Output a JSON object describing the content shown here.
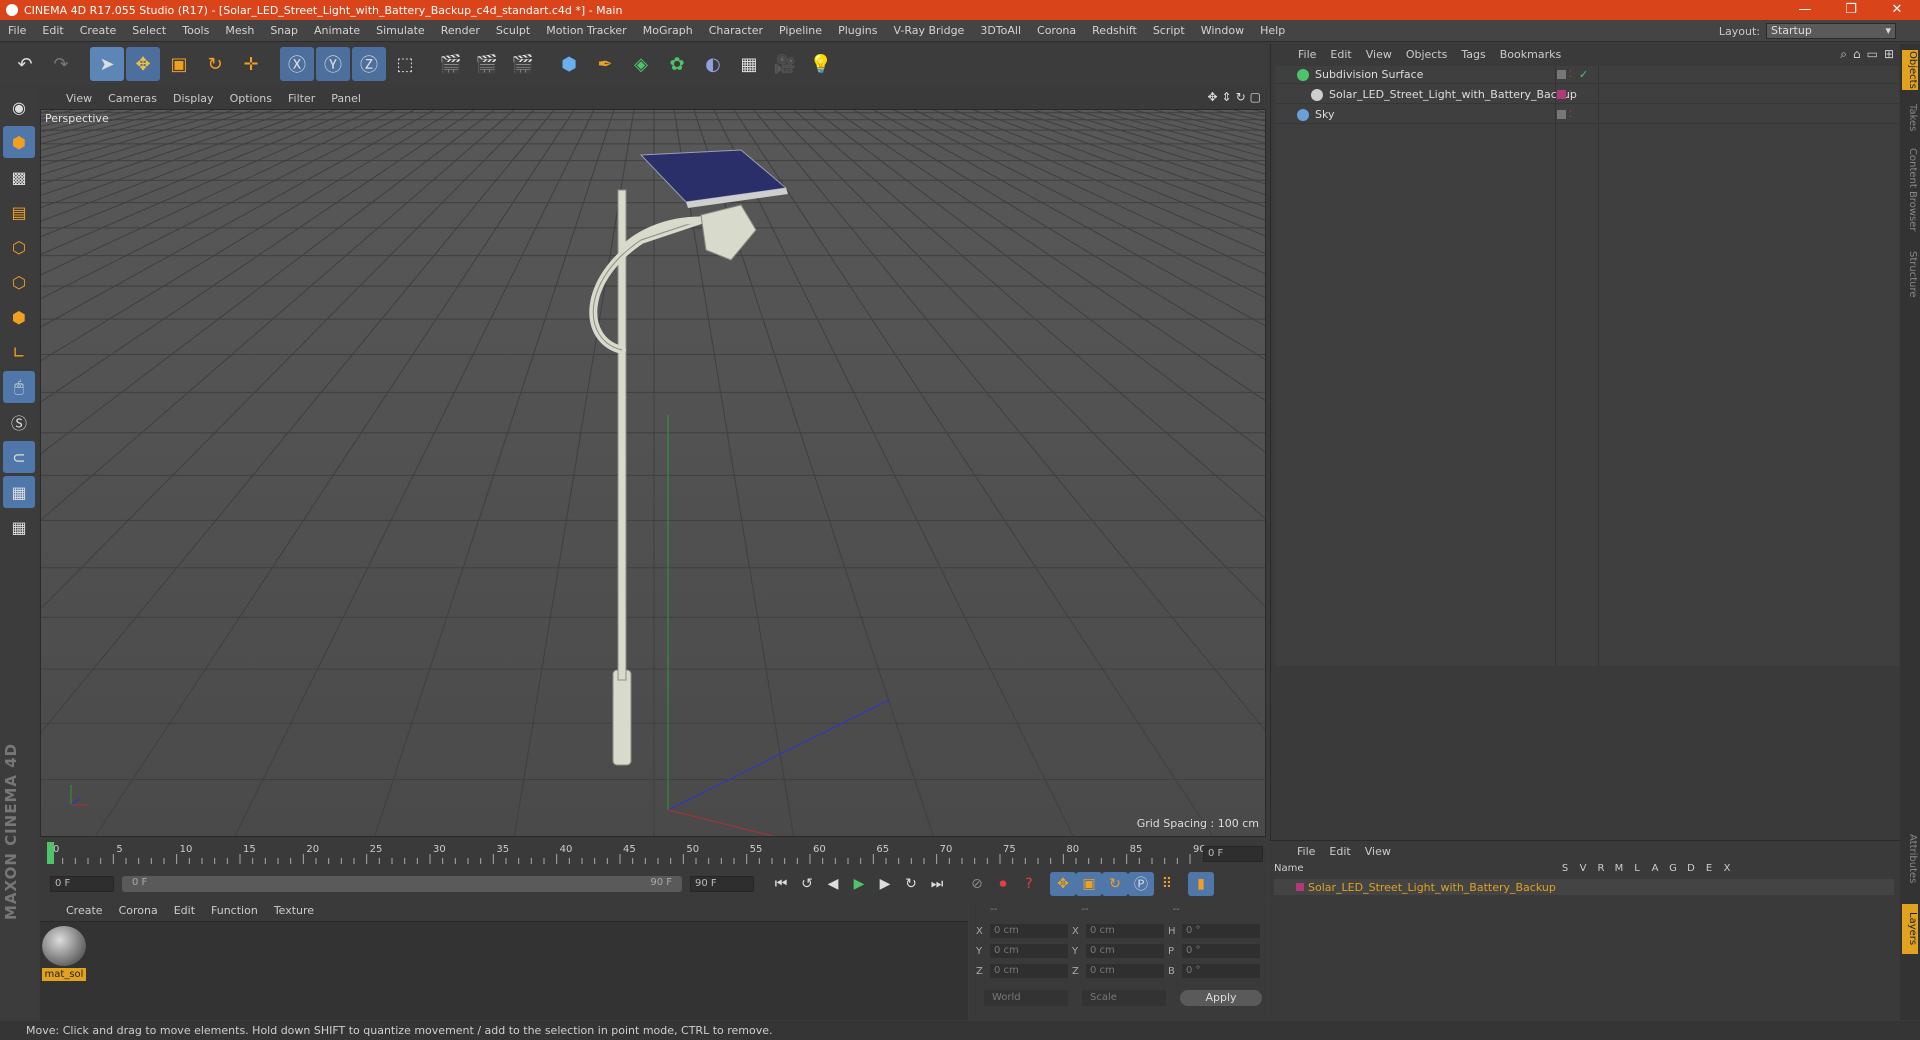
{
  "window": {
    "title": "CINEMA 4D R17.055 Studio (R17) - [Solar_LED_Street_Light_with_Battery_Backup_c4d_standart.c4d *] - Main",
    "controls": [
      "—",
      "❐",
      "✕"
    ]
  },
  "menubar": {
    "items": [
      "File",
      "Edit",
      "Create",
      "Select",
      "Tools",
      "Mesh",
      "Snap",
      "Animate",
      "Simulate",
      "Render",
      "Sculpt",
      "Motion Tracker",
      "MoGraph",
      "Character",
      "Pipeline",
      "Plugins",
      "V-Ray Bridge",
      "3DToAll",
      "Corona",
      "Redshift",
      "Script",
      "Window",
      "Help"
    ],
    "layout_label": "Layout:",
    "layout_value": "Startup"
  },
  "viewport": {
    "menu": [
      "View",
      "Cameras",
      "Display",
      "Options",
      "Filter",
      "Panel"
    ],
    "label": "Perspective",
    "grid_spacing": "Grid Spacing : 100 cm"
  },
  "timeline": {
    "ticks": [
      "0",
      "5",
      "10",
      "15",
      "20",
      "25",
      "30",
      "35",
      "40",
      "45",
      "50",
      "55",
      "60",
      "65",
      "70",
      "75",
      "80",
      "85",
      "90"
    ],
    "current_frame": "0 F",
    "start_field": "0 F",
    "range_start": "0 F",
    "range_end": "90 F",
    "end_field": "90 F"
  },
  "material_panel": {
    "menu": [
      "Create",
      "Corona",
      "Edit",
      "Function",
      "Texture"
    ],
    "material_name": "mat_sol"
  },
  "attributes": {
    "headers": [
      "--",
      "--",
      "--"
    ],
    "rows": [
      {
        "a": "X",
        "av": "0 cm",
        "b": "X",
        "bv": "0 cm",
        "c": "H",
        "cv": "0 °"
      },
      {
        "a": "Y",
        "av": "0 cm",
        "b": "Y",
        "bv": "0 cm",
        "c": "P",
        "cv": "0 °"
      },
      {
        "a": "Z",
        "av": "0 cm",
        "b": "Z",
        "bv": "0 cm",
        "c": "B",
        "cv": "0 °"
      }
    ],
    "coord_mode": "World",
    "scale_mode": "Scale",
    "apply_label": "Apply"
  },
  "objects_panel": {
    "menu": [
      "File",
      "Edit",
      "View",
      "Objects",
      "Tags",
      "Bookmarks"
    ],
    "objects": [
      {
        "name": "Subdivision Surface",
        "color": "#4fc36a"
      },
      {
        "name": "Solar_LED_Street_Light_with_Battery_Backup",
        "color": "#cfcfcf"
      },
      {
        "name": "Sky",
        "color": "#6a9fd8"
      }
    ]
  },
  "layers_panel": {
    "menu": [
      "File",
      "Edit",
      "View"
    ],
    "columns": [
      "Name",
      "S",
      "V",
      "R",
      "M",
      "L",
      "A",
      "G",
      "D",
      "E",
      "X"
    ],
    "layer_name": "Solar_LED_Street_Light_with_Battery_Backup"
  },
  "side_tabs": [
    "Objects",
    "Takes",
    "Content Browser",
    "Structure",
    "Attributes",
    "Layers"
  ],
  "status": "Move: Click and drag to move elements. Hold down SHIFT to quantize movement / add to the selection in point mode, CTRL to remove.",
  "branding": "MAXON CINEMA 4D",
  "colors": {
    "title_bar": "#d9441a",
    "accent_blue": "#4f77a9",
    "highlight_orange": "#e0a21f"
  }
}
